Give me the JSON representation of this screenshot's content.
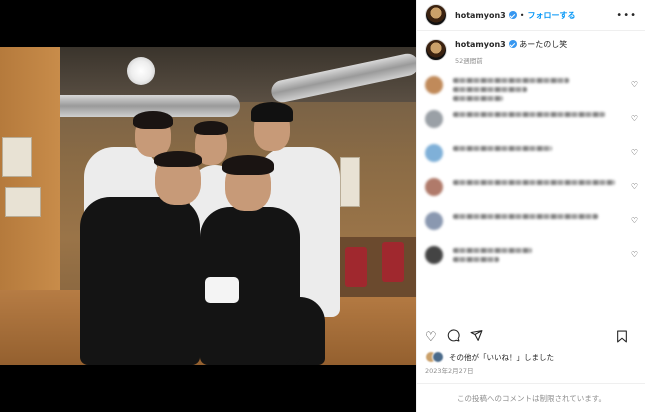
{
  "header": {
    "username": "hotamyon3",
    "follow_label": "フォローする",
    "separator": "•",
    "more_icon": "more-horizontal-icon"
  },
  "caption": {
    "username": "hotamyon3",
    "text": "あーたのし笑",
    "time": "52週間前"
  },
  "comments": [
    {
      "avatar_color": "#c08a5a",
      "lines": 3
    },
    {
      "avatar_color": "#9aa0a6",
      "lines": 1
    },
    {
      "avatar_color": "#7fb0d8",
      "lines": 1
    },
    {
      "avatar_color": "#b07a6a",
      "lines": 1
    },
    {
      "avatar_color": "#8a98b0",
      "lines": 1
    },
    {
      "avatar_color": "#444444",
      "lines": 2
    }
  ],
  "actions": {
    "like_icon": "heart-icon",
    "comment_icon": "comment-icon",
    "share_icon": "share-icon",
    "save_icon": "bookmark-icon"
  },
  "likes_text": "その他が「いいね！」しました",
  "date": "2023年2月27日",
  "footer_text": "この投稿へのコメントは制限されています。",
  "colors": {
    "accent": "#0095f6",
    "verified": "#3797f0",
    "muted": "#8e8e8e"
  }
}
